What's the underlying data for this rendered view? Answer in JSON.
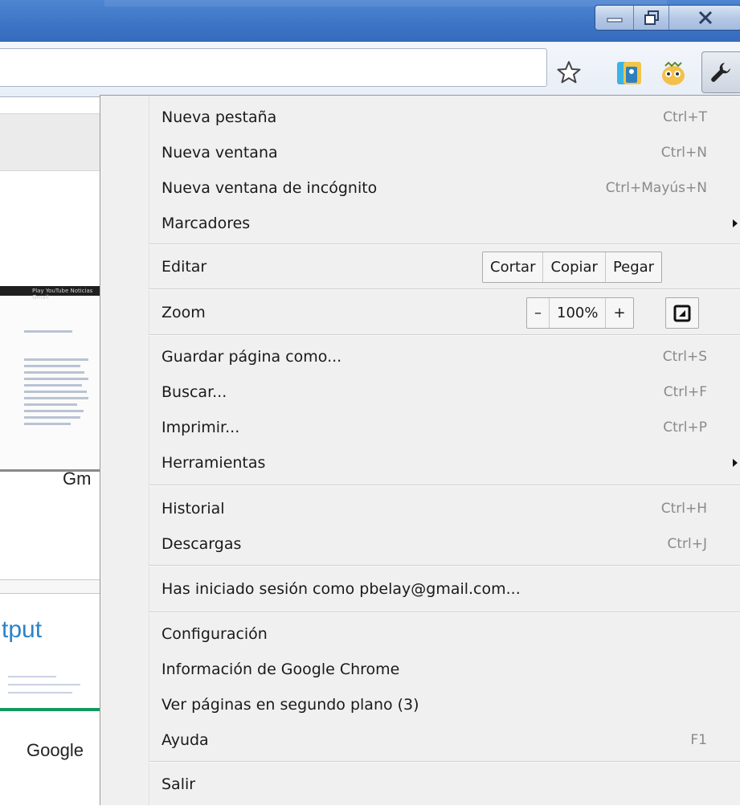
{
  "window": {
    "minimize_icon": "minimize-icon",
    "maximize_icon": "restore-icon",
    "close_icon": "close-icon"
  },
  "toolbar": {
    "bookmark_icon": "star-icon",
    "extension1_icon": "extension-icon",
    "extension2_icon": "extension-icon",
    "menu_icon": "wrench-icon"
  },
  "page": {
    "thumb1_label": "Gm",
    "thumb2_title": "tput",
    "thumb3_label": "Google"
  },
  "menu": {
    "items": [
      {
        "label": "Nueva pestaña",
        "shortcut": "Ctrl+T"
      },
      {
        "label": "Nueva ventana",
        "shortcut": "Ctrl+N"
      },
      {
        "label": "Nueva ventana de incógnito",
        "shortcut": "Ctrl+Mayús+N"
      },
      {
        "label": "Marcadores",
        "shortcut": ""
      },
      {
        "label": "Editar",
        "shortcut": ""
      },
      {
        "label": "Zoom",
        "shortcut": ""
      },
      {
        "label": "Guardar página como...",
        "shortcut": "Ctrl+S"
      },
      {
        "label": "Buscar...",
        "shortcut": "Ctrl+F"
      },
      {
        "label": "Imprimir...",
        "shortcut": "Ctrl+P"
      },
      {
        "label": "Herramientas",
        "shortcut": ""
      },
      {
        "label": "Historial",
        "shortcut": "Ctrl+H"
      },
      {
        "label": "Descargas",
        "shortcut": "Ctrl+J"
      },
      {
        "label": "Has iniciado sesión como pbelay@gmail.com...",
        "shortcut": ""
      },
      {
        "label": "Configuración",
        "shortcut": ""
      },
      {
        "label": "Información de Google Chrome",
        "shortcut": ""
      },
      {
        "label": "Ver páginas en segundo plano (3)",
        "shortcut": ""
      },
      {
        "label": "Ayuda",
        "shortcut": "F1"
      },
      {
        "label": "Salir",
        "shortcut": ""
      }
    ],
    "edit": {
      "cut": "Cortar",
      "copy": "Copiar",
      "paste": "Pegar"
    },
    "zoom": {
      "minus": "–",
      "value": "100%",
      "plus": "+",
      "fullscreen_icon": "fullscreen-icon"
    }
  }
}
